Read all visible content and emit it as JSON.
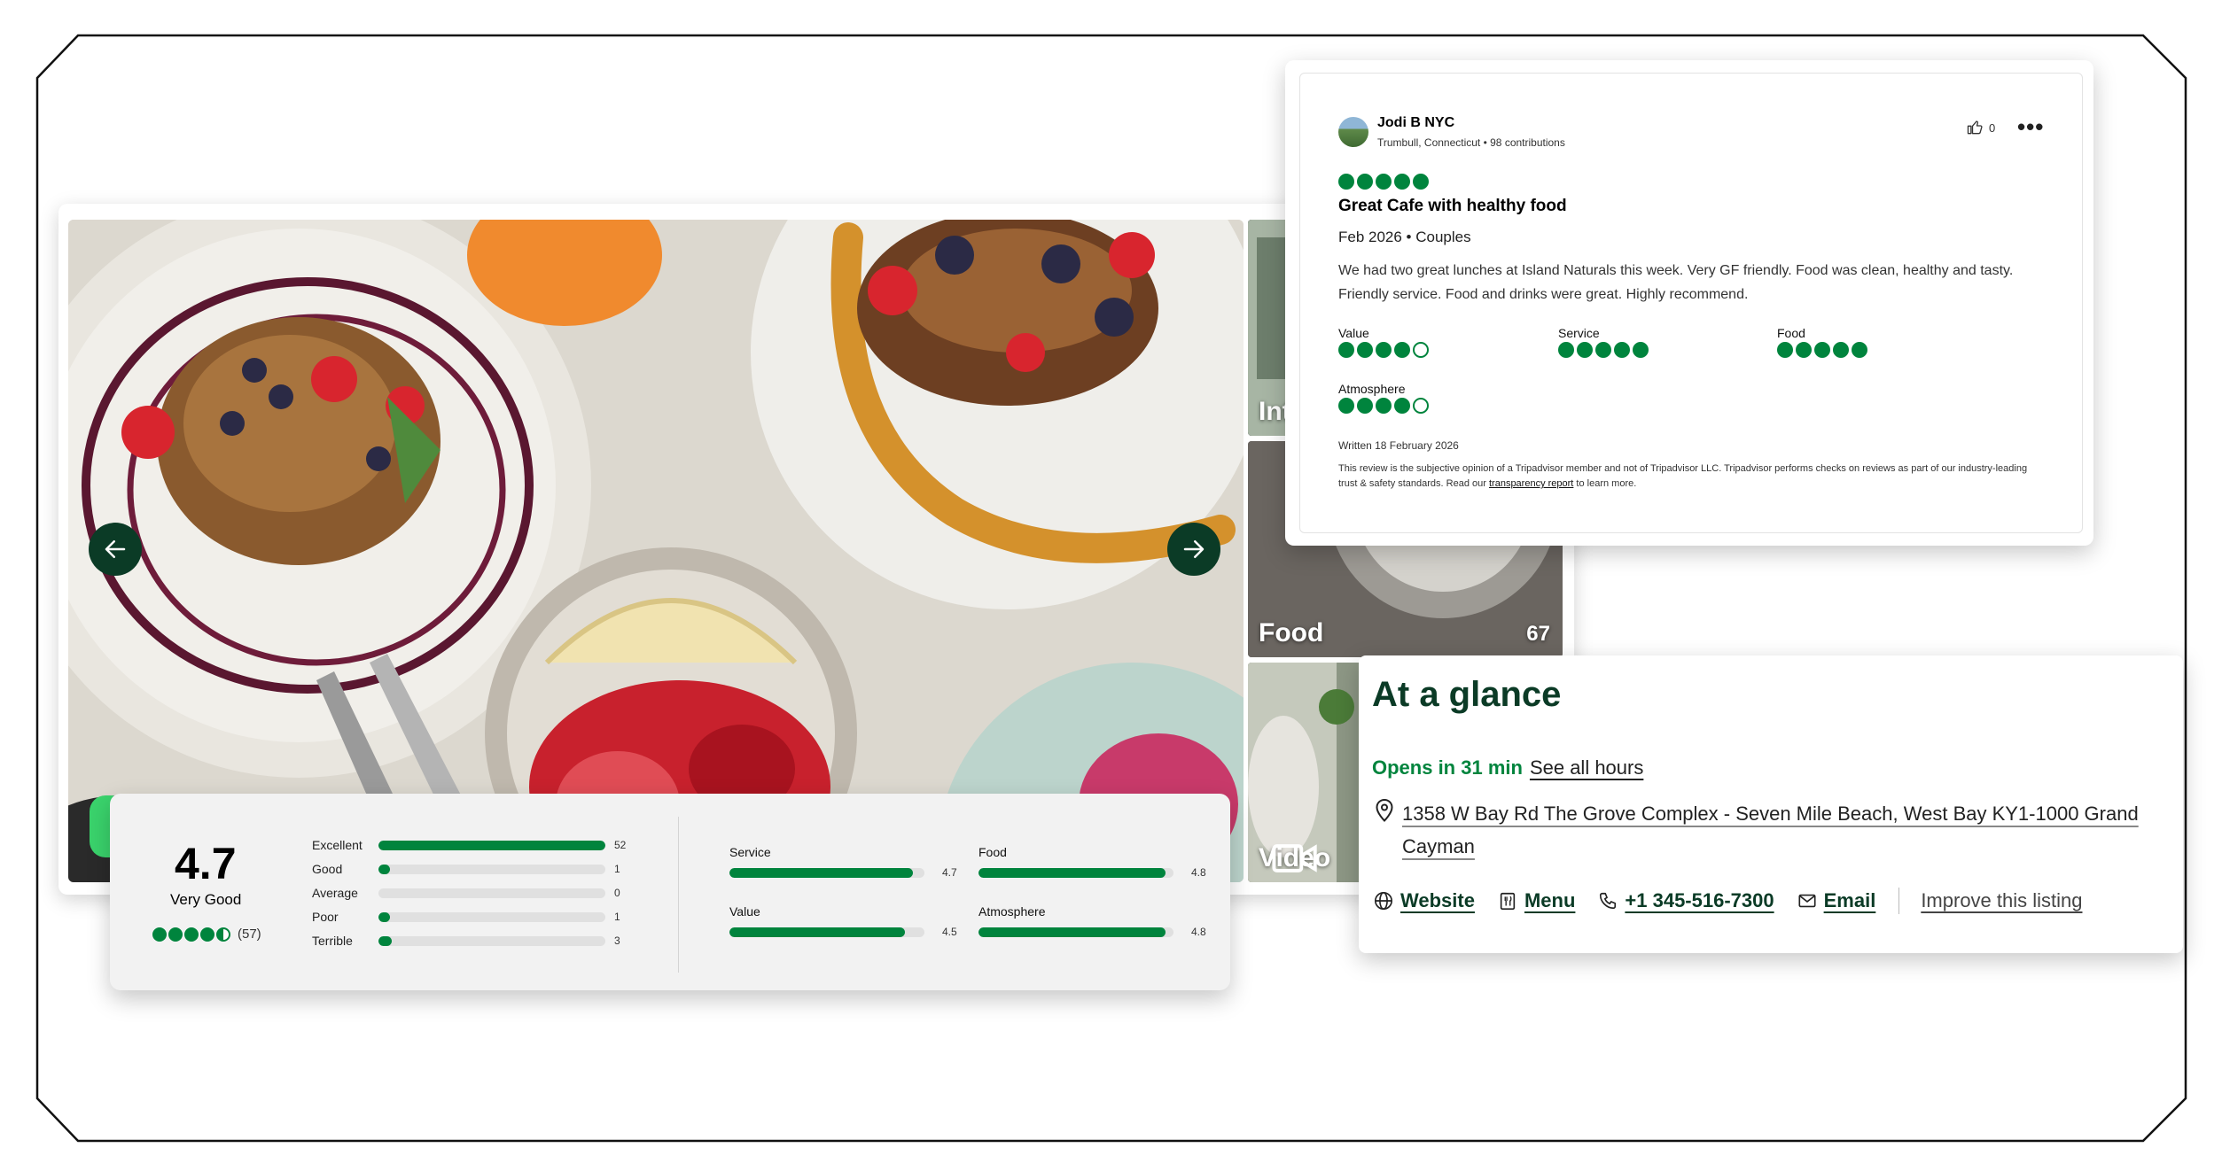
{
  "gallery": {
    "thumbs": [
      {
        "label": "Int",
        "count": ""
      },
      {
        "label": "Food",
        "count": "67"
      },
      {
        "label": "Video",
        "count": ""
      }
    ]
  },
  "rating": {
    "score": "4.7",
    "label": "Very Good",
    "bubbles": 4.5,
    "count": "(57)",
    "distribution": [
      {
        "label": "Excellent",
        "count": 52
      },
      {
        "label": "Good",
        "count": 1
      },
      {
        "label": "Average",
        "count": 0
      },
      {
        "label": "Poor",
        "count": 1
      },
      {
        "label": "Terrible",
        "count": 3
      }
    ],
    "subratings": [
      {
        "label": "Service",
        "value": 4.7
      },
      {
        "label": "Food",
        "value": 4.8
      },
      {
        "label": "Value",
        "value": 4.5
      },
      {
        "label": "Atmosphere",
        "value": 4.8
      }
    ]
  },
  "review": {
    "author": "Jodi B NYC",
    "meta": "Trumbull, Connecticut • 98 contributions",
    "likes": "0",
    "more": "•••",
    "bubbles": 5,
    "title": "Great Cafe with healthy food",
    "date": "Feb 2026 • Couples",
    "body": "We had two great lunches at Island Naturals this week. Very GF friendly. Food was clean, healthy and tasty. Friendly service. Food and drinks were great. Highly recommend.",
    "subratings": [
      {
        "label": "Value",
        "bubbles": 4
      },
      {
        "label": "Service",
        "bubbles": 5
      },
      {
        "label": "Food",
        "bubbles": 5
      },
      {
        "label": "Atmosphere",
        "bubbles": 4
      }
    ],
    "written": "Written 18 February 2026",
    "disclaimer_pre": "This review is the subjective opinion of a Tripadvisor member and not of Tripadvisor LLC. Tripadvisor performs checks on reviews as part of our industry-leading trust & safety standards. Read our ",
    "disclaimer_link": "transparency report",
    "disclaimer_post": " to learn more."
  },
  "glance": {
    "title": "At a glance",
    "open_status": "Opens in 31 min",
    "see_hours": "See all hours",
    "address": "1358 W Bay Rd The Grove Complex - Seven Mile Beach, West Bay KY1-1000 Grand Cayman",
    "website": "Website",
    "menu": "Menu",
    "phone": "+1 345-516-7300",
    "email": "Email",
    "improve": "Improve this listing"
  },
  "colors": {
    "brand_green": "#00843d",
    "dark_green": "#0b3b26"
  }
}
